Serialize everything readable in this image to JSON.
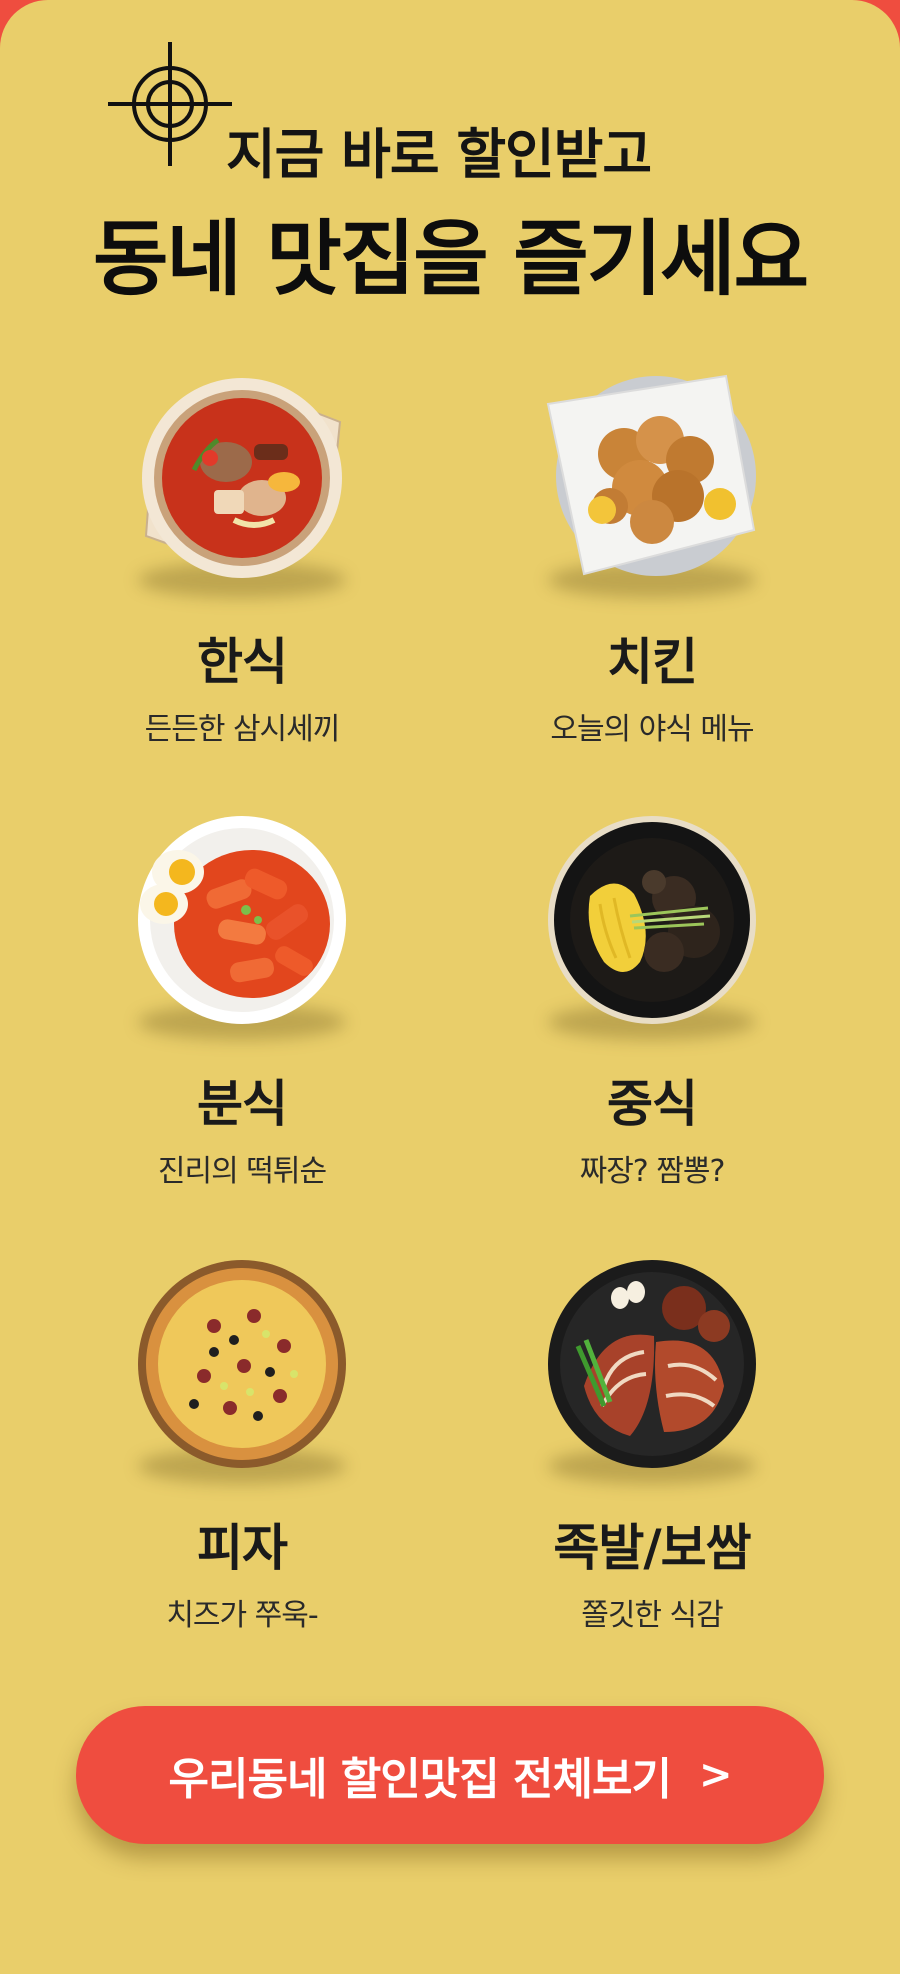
{
  "headline": {
    "sub": "지금 바로 할인받고",
    "main": "동네 맛집을 즐기세요"
  },
  "categories": [
    {
      "name": "한식",
      "desc": "든든한 삼시세끼",
      "icon": "stew-bowl-icon"
    },
    {
      "name": "치킨",
      "desc": "오늘의 야식 메뉴",
      "icon": "fried-chicken-icon"
    },
    {
      "name": "분식",
      "desc": "진리의 떡튀순",
      "icon": "tteokbokki-icon"
    },
    {
      "name": "중식",
      "desc": "짜장? 짬뽕?",
      "icon": "jjajangmyeon-icon"
    },
    {
      "name": "피자",
      "desc": "치즈가 쭈욱-",
      "icon": "pizza-icon"
    },
    {
      "name": "족발/보쌈",
      "desc": "쫄깃한 식감",
      "icon": "jokbal-icon"
    }
  ],
  "cta": {
    "label": "우리동네 할인맛집 전체보기",
    "chevron": ">"
  },
  "colors": {
    "background": "#e9ce6a",
    "accent": "#ef4d3f",
    "text": "#141414"
  }
}
